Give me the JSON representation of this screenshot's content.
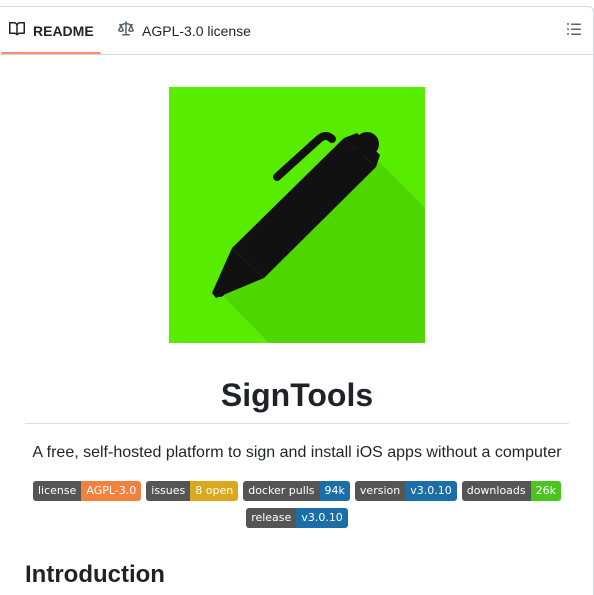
{
  "tabs": [
    {
      "label": "README",
      "icon": "book-icon",
      "active": true
    },
    {
      "label": "AGPL-3.0 license",
      "icon": "law-scale-icon",
      "active": false
    }
  ],
  "outline_icon": "list-unordered-icon",
  "logo": {
    "icon": "pen-icon",
    "background": "#58ed00"
  },
  "title": "SignTools",
  "tagline": "A free, self-hosted platform to sign and install iOS apps without a computer",
  "badges": [
    {
      "key": "license",
      "value": "AGPL-3.0",
      "color": "#f0813f"
    },
    {
      "key": "issues",
      "value": "8 open",
      "color": "#d9a81e"
    },
    {
      "key": "docker pulls",
      "value": "94k",
      "color": "#1b6ea8"
    },
    {
      "key": "version",
      "value": "v3.0.10",
      "color": "#1b6ea8"
    },
    {
      "key": "downloads",
      "value": "26k",
      "color": "#4bc51e"
    },
    {
      "key": "release",
      "value": "v3.0.10",
      "color": "#1b6ea8"
    }
  ],
  "section_heading": "Introduction"
}
